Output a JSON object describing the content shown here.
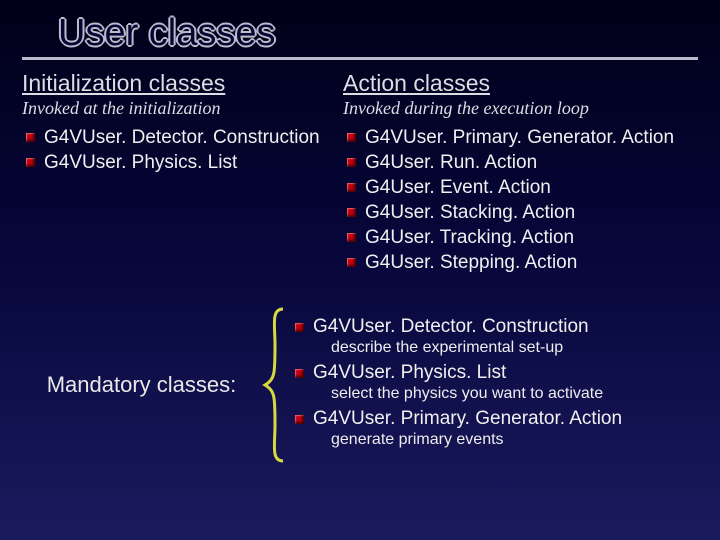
{
  "title": "User classes",
  "left": {
    "heading": "Initialization classes",
    "sub": "Invoked at the initialization",
    "items": [
      "G4VUser. Detector. Construction",
      "G4VUser. Physics. List"
    ]
  },
  "right": {
    "heading": "Action classes",
    "sub": "Invoked during the execution loop",
    "items": [
      "G4VUser. Primary. Generator. Action",
      "G4User. Run. Action",
      "G4User. Event. Action",
      "G4User. Stacking. Action",
      "G4User. Tracking. Action",
      "G4User. Stepping. Action"
    ]
  },
  "mandatory": {
    "label": "Mandatory classes:",
    "entries": [
      {
        "head": "G4VUser. Detector. Construction",
        "desc": "describe the experimental set-up"
      },
      {
        "head": "G4VUser. Physics. List",
        "desc": "select the physics you want to activate"
      },
      {
        "head": "G4VUser. Primary. Generator. Action",
        "desc": "generate primary events"
      }
    ]
  }
}
